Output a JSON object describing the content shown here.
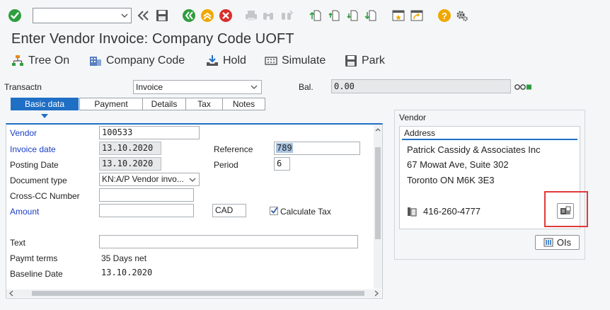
{
  "title": "Enter Vendor Invoice: Company Code UOFT",
  "command_field": {
    "value": ""
  },
  "actions": {
    "tree_on": "Tree On",
    "company_code": "Company Code",
    "hold": "Hold",
    "simulate": "Simulate",
    "park": "Park"
  },
  "transaction": {
    "label": "Transactn",
    "value": "Invoice"
  },
  "balance": {
    "label": "Bal.",
    "value": "0.00"
  },
  "tabs": [
    "Basic data",
    "Payment",
    "Details",
    "Tax",
    "Notes"
  ],
  "basic": {
    "vendor_label": "Vendor",
    "vendor_value": "100533",
    "invoice_date_label": "Invoice date",
    "invoice_date_value": "13.10.2020",
    "posting_date_label": "Posting Date",
    "posting_date_value": "13.10.2020",
    "doc_type_label": "Document type",
    "doc_type_value": "KN:A/P Vendor invo...",
    "cross_cc_label": "Cross-CC Number",
    "cross_cc_value": "",
    "amount_label": "Amount",
    "amount_value": "",
    "currency_value": "CAD",
    "calc_tax_label": "Calculate Tax",
    "reference_label": "Reference",
    "reference_value": "789",
    "period_label": "Period",
    "period_value": "6",
    "text_label": "Text",
    "text_value": "",
    "paymt_terms_label": "Paymt terms",
    "paymt_terms_value": "35 Days net",
    "baseline_date_label": "Baseline Date",
    "baseline_date_value": "13.10.2020"
  },
  "vendor_panel": {
    "title": "Vendor",
    "address_header": "Address",
    "name": "Patrick Cassidy & Associates Inc",
    "street": "67 Mowat Ave, Suite 302",
    "city": "Toronto ON  M6K 3E3",
    "phone": "416-260-4777",
    "ois_button": "OIs"
  },
  "colors": {
    "accent": "#1f6fc5",
    "highlight": "#e03a3a",
    "label_blue": "#1a3fc4"
  }
}
